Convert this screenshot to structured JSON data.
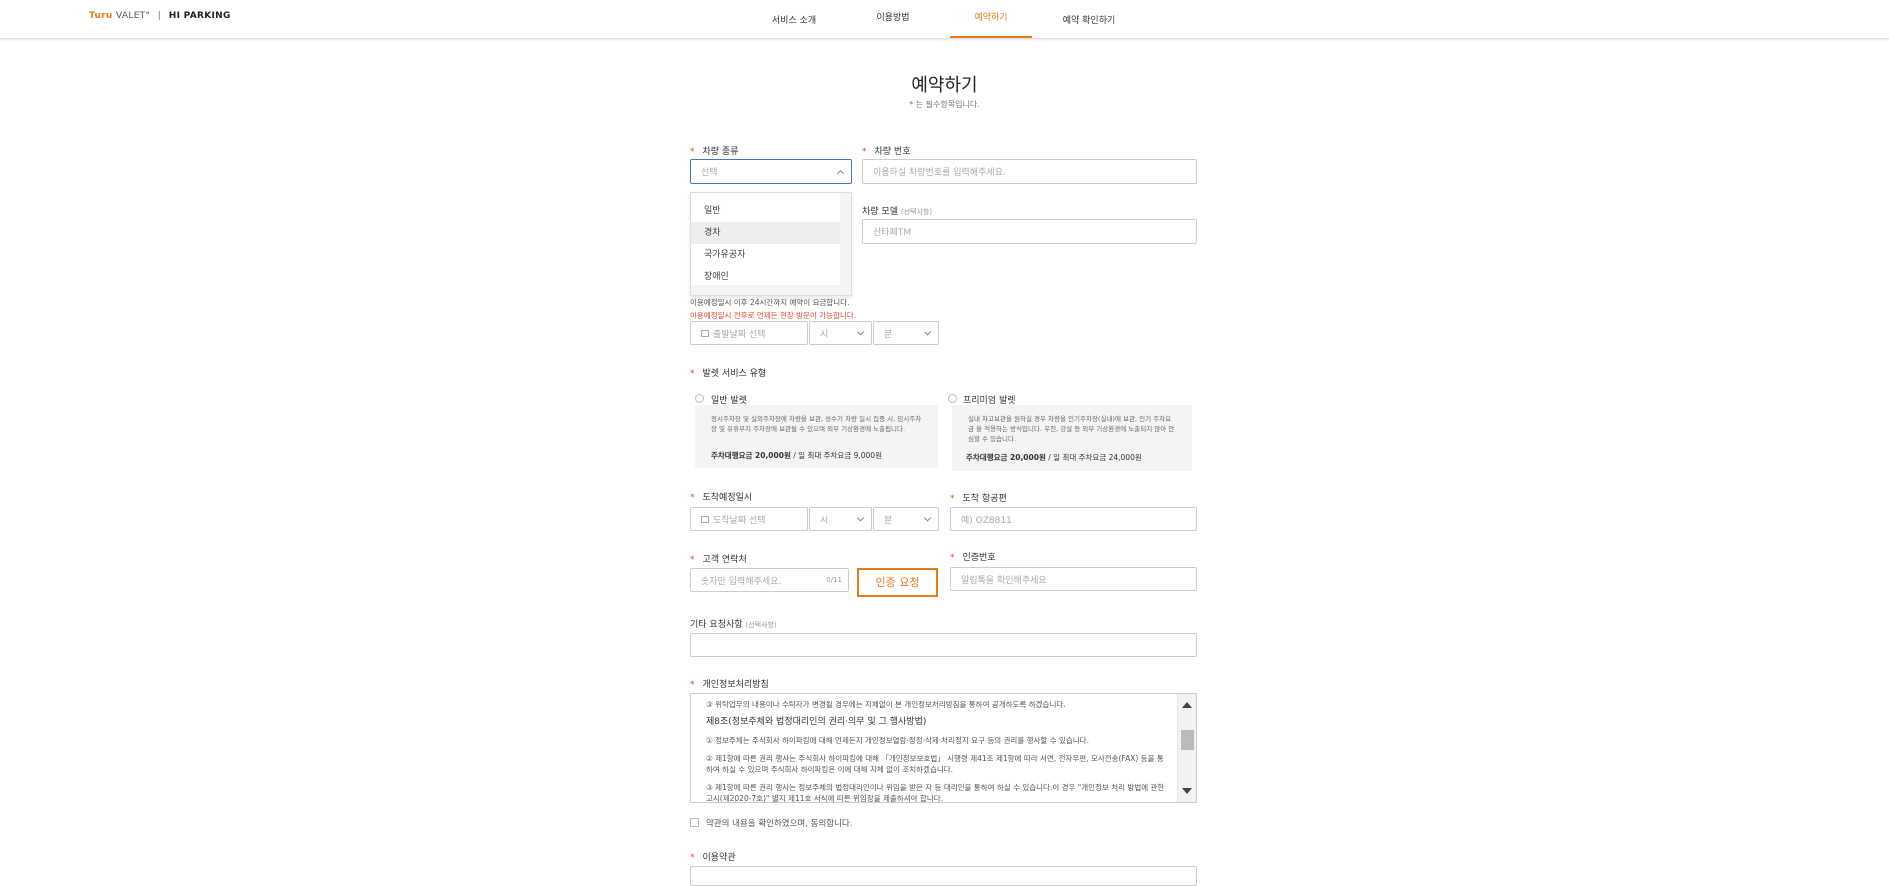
{
  "header": {
    "logo": {
      "turu": "Turu",
      "valet": "VALET",
      "hi": "HI PARKING"
    },
    "nav": [
      {
        "label": "서비스 소개"
      },
      {
        "label": "이용방법"
      },
      {
        "label": "예약하기",
        "active": true
      },
      {
        "label": "예약 확인하기"
      }
    ]
  },
  "page": {
    "title": "예약하기",
    "subtitle": "* 는 필수항목입니다."
  },
  "vehicle_type": {
    "label": "차량 종류",
    "placeholder": "선택",
    "options": [
      "일반",
      "경차",
      "국가유공자",
      "장애인"
    ],
    "hovered": "경차"
  },
  "vehicle_number": {
    "label": "차량 번호",
    "placeholder": "이용하실 차량번호를 입력해주세요."
  },
  "vehicle_model": {
    "label": "차량 모델",
    "optional": "(선택사항)",
    "placeholder": "산타페TM"
  },
  "departure": {
    "notice1": "이용예정일시 이후 24시간까지 예약이 요금합니다.",
    "notice2": "이용예정일시 전후로 언제든 현장 방문이 가능합니다.",
    "date_placeholder": "출발날짜 선택",
    "hour_placeholder": "시",
    "minute_placeholder": "분"
  },
  "valet_service": {
    "label": "발렛 서비스 유형",
    "general": {
      "label": "일반 발렛",
      "desc": "정시주차장 및 실외주차장에 차량을 보관, 성수기 차량 일시 집중 시, 임시주차장 및 유휴부지 주차장에 보관될 수 있으며 외부 기상환경에 노출됩니다.",
      "price_label": "주차대행요금 20,000원",
      "price_rest": " / 일 최대 주차요금 9,000원"
    },
    "premium": {
      "label": "프리미엄 발렛",
      "desc": "실내 차고보관을 원하실 경우 차량을 인기주차장(실내)에 보관, 인기 주차요금 을 적용하는 방식입니다. 우천, 강설 등 외부 기상환경에 노출되지 않아 안심할 수 있습니다.",
      "price_label": "주차대행요금 20,000원",
      "price_rest": " / 일 최대 주차요금 24,000원"
    }
  },
  "arrival": {
    "label": "도착예정일시",
    "date_placeholder": "도착날짜 선택",
    "hour_placeholder": "시",
    "minute_placeholder": "분"
  },
  "flight": {
    "label": "도착 항공편",
    "placeholder": "예) OZ8811"
  },
  "contact": {
    "label": "고객 연락처",
    "placeholder": "숫자만 입력해주세요.",
    "counter": "0/11",
    "auth_button": "인증 요청"
  },
  "auth_code": {
    "label": "인증번호",
    "placeholder": "알림톡을 확인해주세요"
  },
  "request": {
    "label": "기타 요청사항",
    "optional": "(선택사항)"
  },
  "privacy": {
    "label": "개인정보처리방침",
    "lines": [
      "③ 위탁업무의 내용이나 수탁자가 변경될 경우에는 지체없이 본 개인정보처리방침을 통하여 공개하도록 하겠습니다.",
      "제8조(정보주체와 법정대리인의 권리·의무 및 그 행사방법)",
      "① 정보주체는 주식회사 하이파킹에 대해 언제든지 개인정보열람·정정·삭제·처리정지 요구 등의 권리를 행사할 수 있습니다.",
      "② 제1항에 따른 권리 행사는 주식회사 하이파킹에 대해 「개인정보보호법」 시행령 제41조 제1항에 따라 서면, 전자우편, 모사전송(FAX) 등을 통하여 하실 수 있으며 주식회사 하이파킹은 이에 대해 지체 없이 조치하겠습니다.",
      "③ 제1항에 따른 권리 행사는 정보주체의 법정대리인이나 위임을 받은 자 등 대리인을 통하여 하실 수 있습니다.이 경우 \"개인정보 처리 방법에 관한 고시(제2020-7호)\" 별지 제11호 서식에 따른 위임장을 제출하셔야 합니다."
    ],
    "agree": "약관의 내용을 확인하였으며, 동의합니다."
  },
  "terms": {
    "label": "이용약관"
  }
}
